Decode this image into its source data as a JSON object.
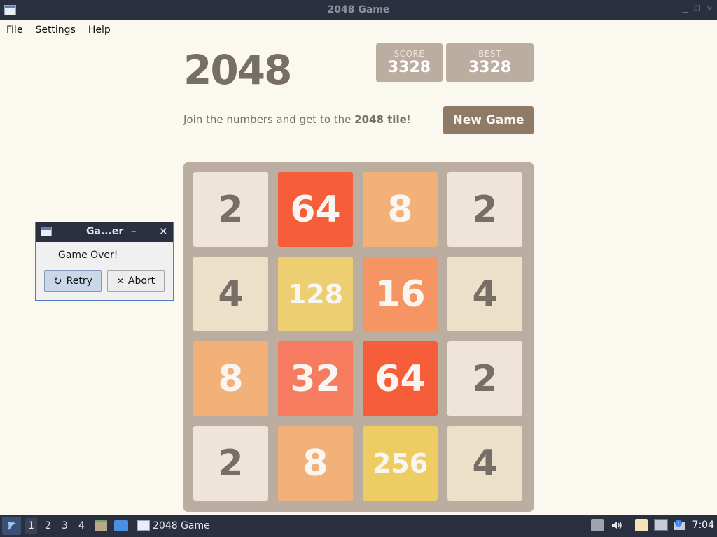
{
  "window": {
    "title": "2048 Game"
  },
  "menu": {
    "items": [
      "File",
      "Settings",
      "Help"
    ]
  },
  "game": {
    "title": "2048",
    "score_label": "SCORE",
    "score": "3328",
    "best_label": "BEST",
    "best": "3328",
    "intro_prefix": "Join the numbers and get to the ",
    "intro_bold": "2048 tile",
    "intro_suffix": "!",
    "new_game_label": "New Game"
  },
  "board": {
    "tiles": [
      [
        "2",
        "64",
        "8",
        "2"
      ],
      [
        "4",
        "128",
        "16",
        "4"
      ],
      [
        "8",
        "32",
        "64",
        "2"
      ],
      [
        "2",
        "8",
        "256",
        "4"
      ]
    ]
  },
  "dialog": {
    "title": "Ga...er",
    "message": "Game Over!",
    "retry_label": "Retry",
    "abort_label": "Abort"
  },
  "taskbar": {
    "workspaces": [
      "1",
      "2",
      "3",
      "4"
    ],
    "task_label": "2048 Game",
    "clock": "7:04"
  },
  "colors": {
    "tile_2": "#eee4da",
    "tile_4": "#ede0c8",
    "tile_8": "#f2b179",
    "tile_16": "#f59563",
    "tile_32": "#f67c5f",
    "tile_64": "#f65e3b",
    "tile_128": "#edcf72",
    "tile_256": "#edcc61",
    "board": "#bbada0",
    "dark_text": "#776e65",
    "light_text": "#f9f6f2"
  }
}
